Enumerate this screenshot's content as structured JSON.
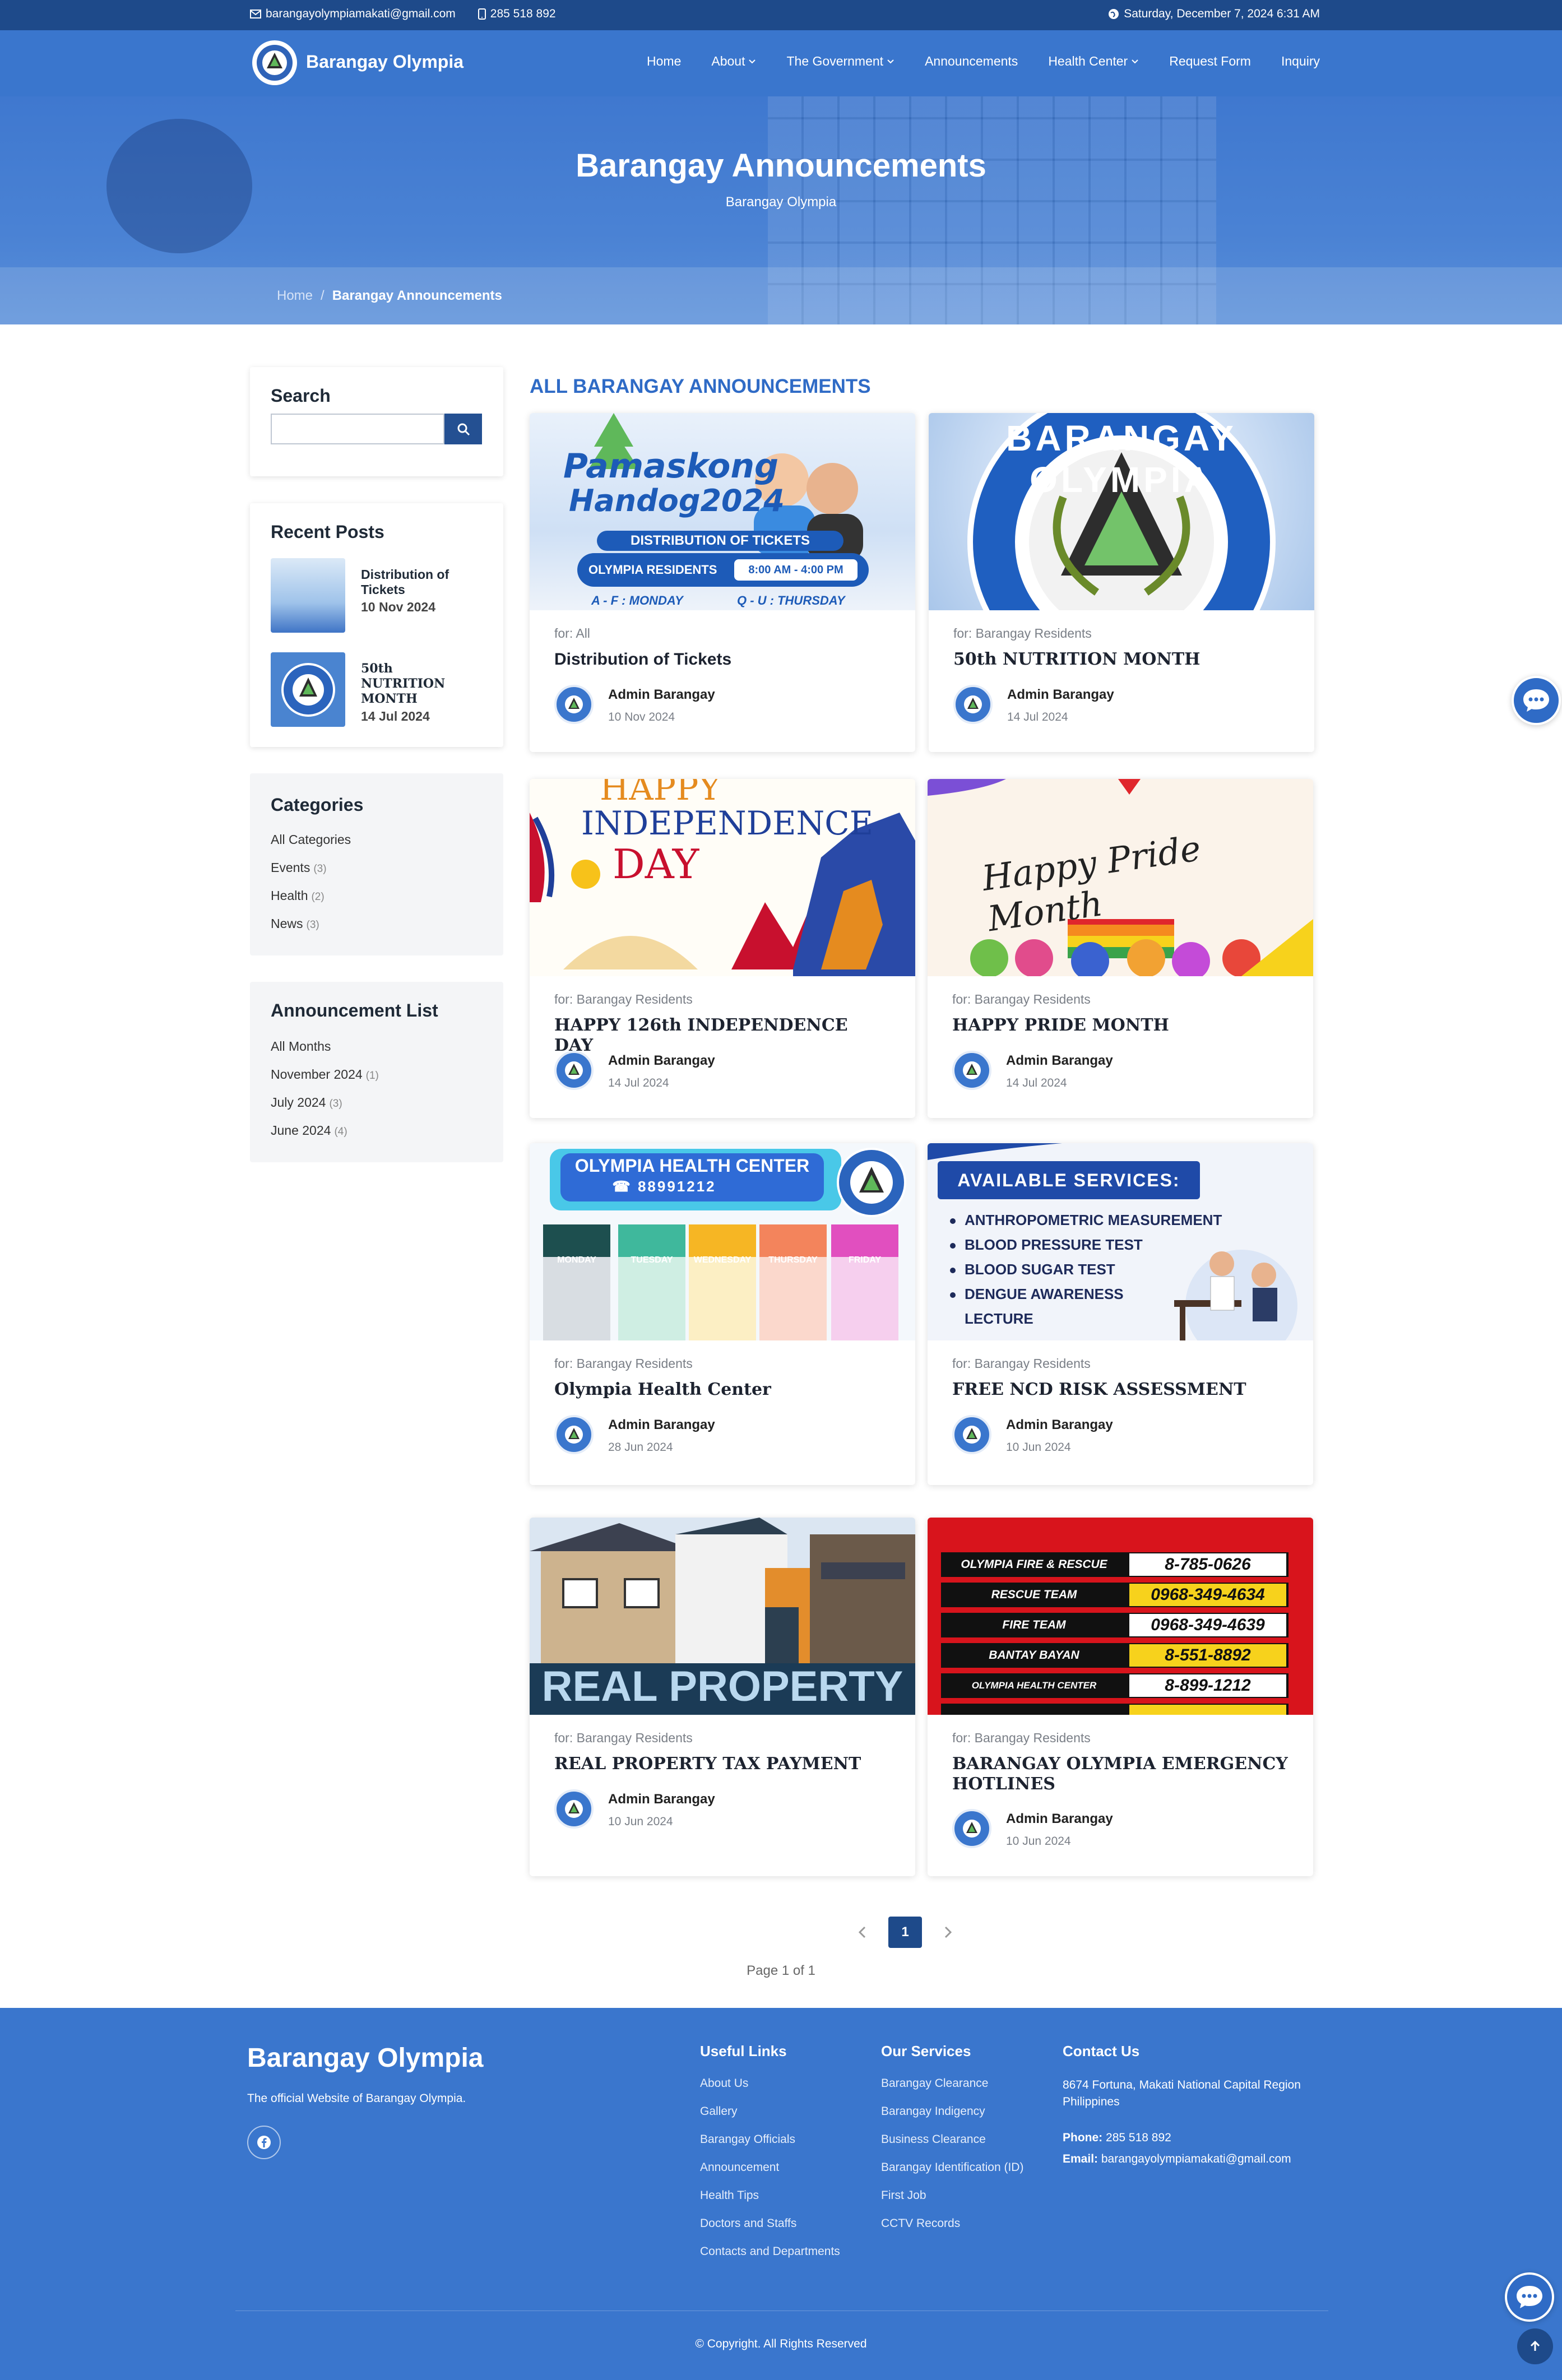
{
  "topbar": {
    "email": "barangayolympiamakati@gmail.com",
    "phone": "285 518 892",
    "datetime": "Saturday, December 7, 2024 6:31 AM"
  },
  "nav": {
    "brand": "Barangay Olympia",
    "items": [
      "Home",
      "About",
      "The Government",
      "Announcements",
      "Health Center",
      "Request Form",
      "Inquiry"
    ]
  },
  "hero": {
    "title": "Barangay Announcements",
    "subtitle": "Barangay Olympia",
    "breadcrumb": {
      "home": "Home",
      "sep": "/",
      "current": "Barangay Announcements"
    }
  },
  "sidebar": {
    "search_title": "Search",
    "recent_title": "Recent Posts",
    "recent": [
      {
        "title": "Distribution of Tickets",
        "date": "10 Nov 2024"
      },
      {
        "title": "50th NUTRITION MONTH",
        "date": "14 Jul 2024"
      }
    ],
    "categories_title": "Categories",
    "categories": [
      {
        "label": "All Categories",
        "count": ""
      },
      {
        "label": "Events",
        "count": "(3)"
      },
      {
        "label": "Health",
        "count": "(2)"
      },
      {
        "label": "News",
        "count": "(3)"
      }
    ],
    "list_title": "Announcement List",
    "months": [
      {
        "label": "All Months",
        "count": ""
      },
      {
        "label": "November 2024",
        "count": "(1)"
      },
      {
        "label": "July 2024",
        "count": "(3)"
      },
      {
        "label": "June 2024",
        "count": "(4)"
      }
    ]
  },
  "main": {
    "section_title": "ALL BARANGAY ANNOUNCEMENTS",
    "posts": [
      {
        "for": "for: All",
        "title": "Distribution of Tickets",
        "author": "Admin Barangay",
        "date": "10 Nov 2024",
        "img": {
          "l1": "Pamaskong",
          "l2": "Handog2024",
          "l3": "DISTRIBUTION OF TICKETS",
          "l4": "OLYMPIA RESIDENTS",
          "l5": "8:00 AM - 4:00 PM",
          "l6": "A - F : MONDAY",
          "l7": "Q - U : THURSDAY"
        }
      },
      {
        "for": "for: Barangay Residents",
        "title": "50th NUTRITION MONTH",
        "author": "Admin Barangay",
        "date": "14 Jul 2024",
        "img": {
          "l1": "BARANGAY OLYMPIA"
        }
      },
      {
        "for": "for: Barangay Residents",
        "title": "HAPPY 126th INDEPENDENCE DAY",
        "author": "Admin Barangay",
        "date": "14 Jul 2024",
        "img": {
          "l1": "HAPPY",
          "l2": "INDEPENDENCE",
          "l3": "DAY"
        }
      },
      {
        "for": "for: Barangay Residents",
        "title": "HAPPY PRIDE MONTH",
        "author": "Admin Barangay",
        "date": "14 Jul 2024",
        "img": {
          "l1": "Happy Pride Month"
        }
      },
      {
        "for": "for: Barangay Residents",
        "title": "Olympia Health Center",
        "author": "Admin Barangay",
        "date": "28 Jun 2024",
        "img": {
          "l1": "OLYMPIA HEALTH CENTER",
          "l2": "☎ 88991212",
          "days": [
            "MONDAY",
            "TUESDAY",
            "WEDNESDAY",
            "THURSDAY",
            "FRIDAY"
          ]
        }
      },
      {
        "for": "for: Barangay Residents",
        "title": "FREE NCD RISK ASSESSMENT",
        "author": "Admin Barangay",
        "date": "10 Jun 2024",
        "img": {
          "l1": "AVAILABLE SERVICES:",
          "items": [
            "ANTHROPOMETRIC MEASUREMENT",
            "BLOOD PRESSURE TEST",
            "BLOOD SUGAR TEST",
            "DENGUE AWARENESS",
            "LECTURE"
          ]
        }
      },
      {
        "for": "for: Barangay Residents",
        "title": "REAL PROPERTY TAX PAYMENT",
        "author": "Admin Barangay",
        "date": "10 Jun 2024",
        "img": {
          "l1": "REAL PROPERTY"
        }
      },
      {
        "for": "for: Barangay Residents",
        "title": "BARANGAY OLYMPIA EMERGENCY HOTLINES",
        "author": "Admin Barangay",
        "date": "10 Jun 2024",
        "img": {
          "rows": [
            [
              "OLYMPIA FIRE & RESCUE",
              "8-785-0626"
            ],
            [
              "RESCUE TEAM",
              "0968-349-4634"
            ],
            [
              "FIRE TEAM",
              "0968-349-4639"
            ],
            [
              "BANTAY BAYAN",
              "8-551-8892"
            ],
            [
              "OLYMPIA HEALTH CENTER",
              "8-899-1212"
            ]
          ]
        }
      }
    ]
  },
  "pagination": {
    "current": "1",
    "label": "Page 1 of 1"
  },
  "footer": {
    "brand": "Barangay Olympia",
    "tagline": "The official Website of Barangay Olympia.",
    "useful_title": "Useful Links",
    "useful": [
      "About Us",
      "Gallery",
      "Barangay Officials",
      "Announcement",
      "Health Tips",
      "Doctors and Staffs",
      "Contacts and Departments"
    ],
    "services_title": "Our Services",
    "services": [
      "Barangay Clearance",
      "Barangay Indigency",
      "Business Clearance",
      "Barangay Identification (ID)",
      "First Job",
      "CCTV Records"
    ],
    "contact_title": "Contact Us",
    "address": "8674 Fortuna, Makati National Capital Region Philippines",
    "phone_label": "Phone:",
    "phone": "285 518 892",
    "email_label": "Email:",
    "email": "barangayolympiamakati@gmail.com",
    "copyright": "© Copyright. All Rights Reserved"
  },
  "colors": {
    "primary": "#3a76cd",
    "dark": "#1e4a8a",
    "accent_title": "#2f6bc6"
  }
}
